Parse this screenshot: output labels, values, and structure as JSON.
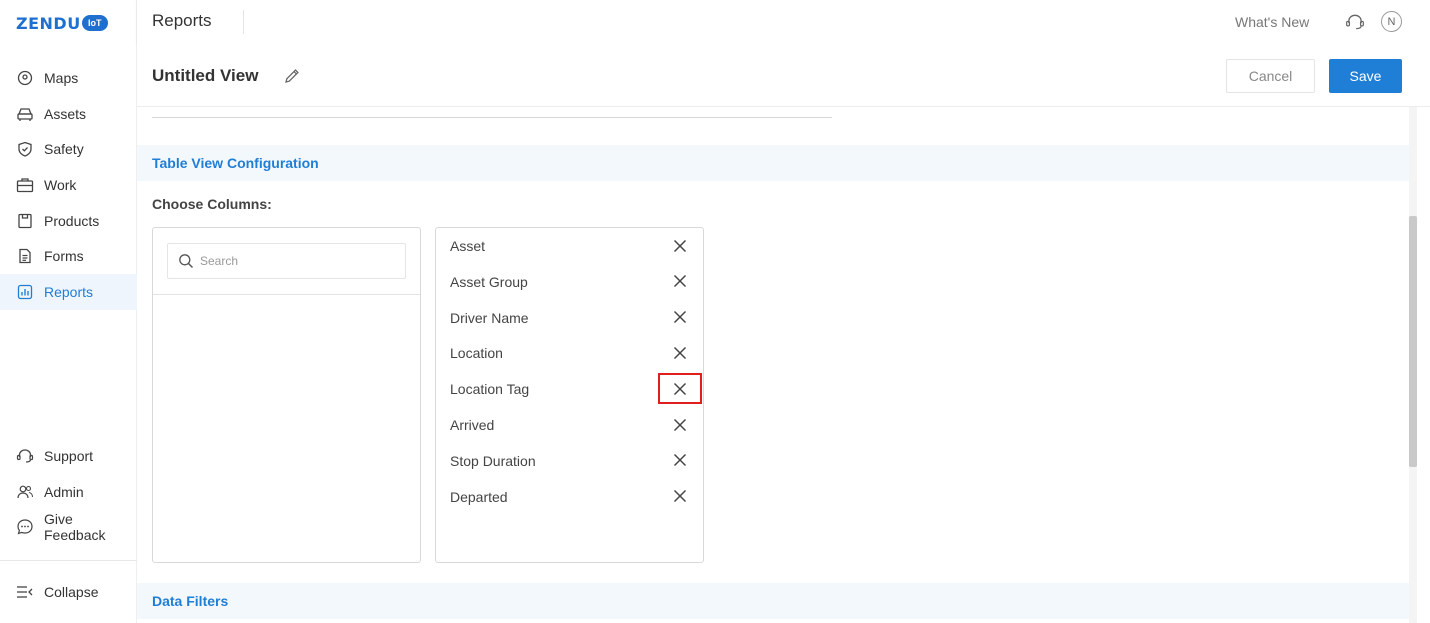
{
  "brand": {
    "logo_text": "ZENDU",
    "logo_badge": "IoT",
    "accent_color": "#1f7ed6"
  },
  "sidebar": {
    "items": [
      {
        "label": "Maps",
        "icon": "map-pin-icon"
      },
      {
        "label": "Assets",
        "icon": "car-icon"
      },
      {
        "label": "Safety",
        "icon": "shield-icon"
      },
      {
        "label": "Work",
        "icon": "briefcase-icon"
      },
      {
        "label": "Products",
        "icon": "clipboard-icon"
      },
      {
        "label": "Forms",
        "icon": "document-icon"
      },
      {
        "label": "Reports",
        "icon": "bar-chart-icon",
        "active": true
      }
    ],
    "bottom_items": [
      {
        "label": "Support",
        "icon": "headset-icon"
      },
      {
        "label": "Admin",
        "icon": "users-icon"
      },
      {
        "label": "Give Feedback",
        "icon": "chat-bubble-icon"
      }
    ],
    "collapse_label": "Collapse"
  },
  "topbar": {
    "title": "Reports",
    "whats_new": "What's New",
    "avatar_initial": "N"
  },
  "view": {
    "title": "Untitled View",
    "cancel_label": "Cancel",
    "save_label": "Save"
  },
  "table_config": {
    "section_title": "Table View Configuration",
    "choose_columns_label": "Choose Columns:",
    "search_placeholder": "Search",
    "selected_columns": [
      "Asset",
      "Asset Group",
      "Driver Name",
      "Location",
      "Location Tag",
      "Arrived",
      "Stop Duration",
      "Departed"
    ],
    "highlighted_remove_index": 4
  },
  "data_filters": {
    "section_title": "Data Filters"
  }
}
